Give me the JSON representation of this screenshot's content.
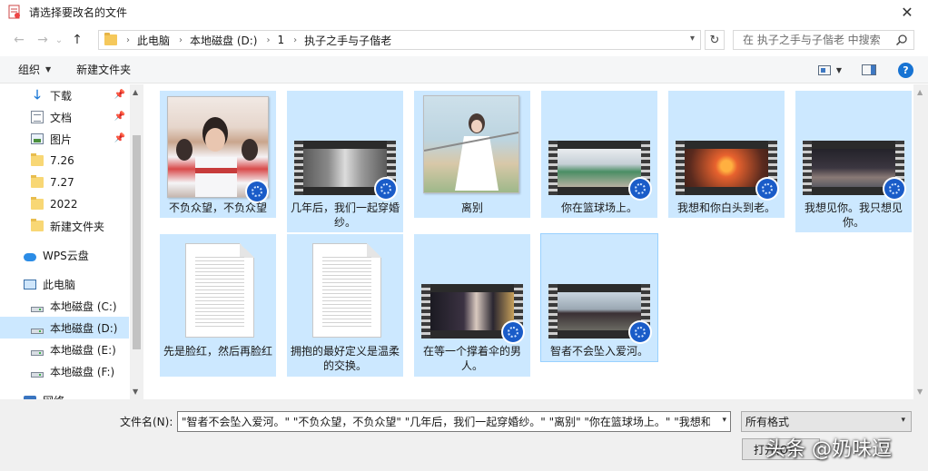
{
  "window": {
    "title": "请选择要改名的文件",
    "close_glyph": "✕"
  },
  "nav": {
    "back_glyph": "←",
    "forward_glyph": "→",
    "recent_glyph": "⌄",
    "up_glyph": "↑",
    "breadcrumb": [
      "此电脑",
      "本地磁盘 (D:)",
      "1",
      "执子之手与子偕老"
    ],
    "refresh_glyph": "↻",
    "search_placeholder": "在 执子之手与子偕老 中搜索"
  },
  "toolbar": {
    "organize_label": "组织",
    "new_folder_label": "新建文件夹",
    "help_glyph": "?"
  },
  "sidebar": {
    "items": [
      {
        "label": "下载",
        "icon": "download-icon",
        "pinned": true
      },
      {
        "label": "文档",
        "icon": "document-icon",
        "pinned": true
      },
      {
        "label": "图片",
        "icon": "picture-icon",
        "pinned": true
      },
      {
        "label": "7.26",
        "icon": "folder-icon"
      },
      {
        "label": "7.27",
        "icon": "folder-icon"
      },
      {
        "label": "2022",
        "icon": "folder-icon"
      },
      {
        "label": "新建文件夹",
        "icon": "folder-icon"
      },
      {
        "label": "WPS云盘",
        "icon": "cloud-icon"
      },
      {
        "label": "此电脑",
        "icon": "computer-icon"
      },
      {
        "label": "本地磁盘 (C:)",
        "icon": "drive-icon"
      },
      {
        "label": "本地磁盘 (D:)",
        "icon": "drive-icon",
        "selected": true
      },
      {
        "label": "本地磁盘 (E:)",
        "icon": "drive-icon"
      },
      {
        "label": "本地磁盘 (F:)",
        "icon": "drive-icon"
      },
      {
        "label": "网络",
        "icon": "network-icon"
      }
    ]
  },
  "files": [
    {
      "name": "不负众望，不负众望",
      "kind": "video-photo"
    },
    {
      "name": "几年后，我们一起穿婚纱。",
      "kind": "video"
    },
    {
      "name": "离别",
      "kind": "photo"
    },
    {
      "name": "你在篮球场上。",
      "kind": "video"
    },
    {
      "name": "我想和你白头到老。",
      "kind": "video"
    },
    {
      "name": "我想见你。我只想见你。",
      "kind": "video"
    },
    {
      "name": "先是脸红，然后再脸红",
      "kind": "text"
    },
    {
      "name": "拥抱的最好定义是温柔的交换。",
      "kind": "text"
    },
    {
      "name": "在等一个撑着伞的男人。",
      "kind": "video"
    },
    {
      "name": "智者不会坠入爱河。",
      "kind": "video"
    }
  ],
  "bottom": {
    "filename_label": "文件名(N):",
    "filename_value": "\"智者不会坠入爱河。\" \"不负众望，不负众望\" \"几年后，我们一起穿婚纱。\" \"离别\" \"你在篮球场上。\" \"我想和你",
    "filter_value": "所有格式",
    "open_label": "打开(O)",
    "watermark": "头条 @奶味逗"
  },
  "colors": {
    "selection": "#cce8ff",
    "accent": "#1773d3",
    "folder": "#f8d775"
  }
}
